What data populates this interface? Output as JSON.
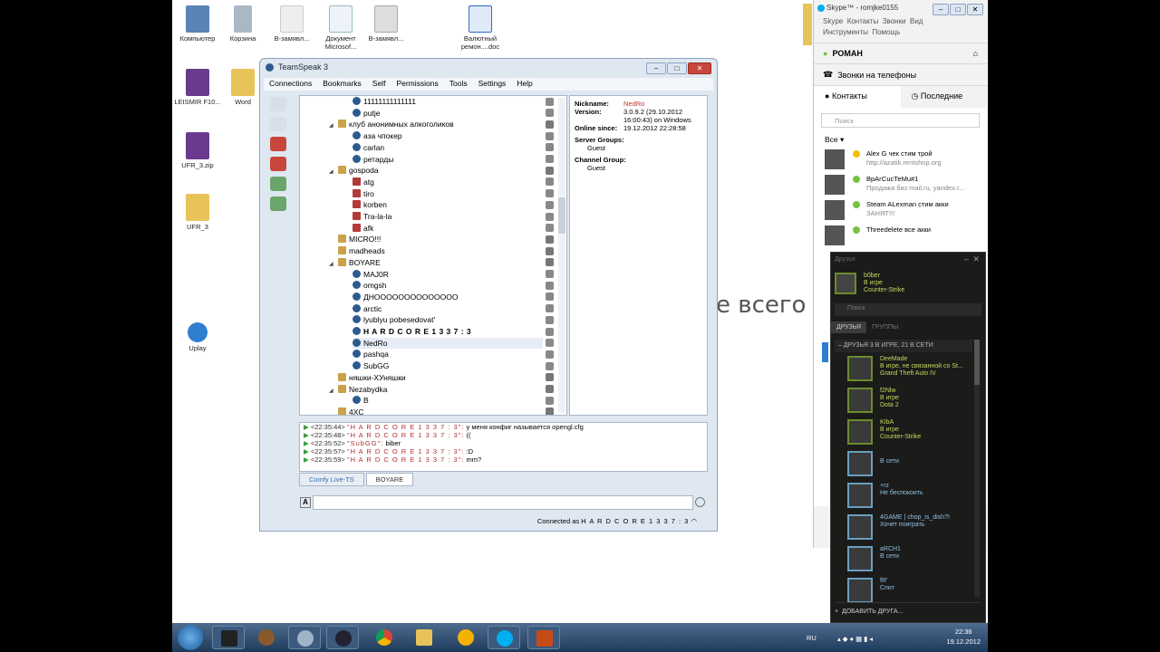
{
  "desktop": {
    "icons": [
      {
        "label": "Компьютер"
      },
      {
        "label": "Корзина"
      },
      {
        "label": "В-замявл..."
      },
      {
        "label": "Документ Microsof..."
      },
      {
        "label": "В-замявл..."
      },
      {
        "label": "Валютный ремон....doc"
      },
      {
        "label": "LEISMIR F10..."
      },
      {
        "label": "Word"
      },
      {
        "label": "UFR_3.zip"
      },
      {
        "label": "UFR_3"
      },
      {
        "label": "Uplay"
      }
    ],
    "background_text": "е всего"
  },
  "teamspeak": {
    "title": "TeamSpeak 3",
    "menu": [
      "Connections",
      "Bookmarks",
      "Self",
      "Permissions",
      "Tools",
      "Settings",
      "Help"
    ],
    "tree": [
      {
        "type": "client",
        "indent": 2,
        "label": "11111111111111"
      },
      {
        "type": "client",
        "indent": 2,
        "label": "putje"
      },
      {
        "type": "channel",
        "indent": 1,
        "label": "клуб анонимных алкоголиков",
        "expand": true
      },
      {
        "type": "client",
        "indent": 2,
        "label": "аза чпокер"
      },
      {
        "type": "client",
        "indent": 2,
        "label": "carlan"
      },
      {
        "type": "client",
        "indent": 2,
        "label": "ретарды"
      },
      {
        "type": "channel",
        "indent": 1,
        "label": "gospoda",
        "expand": true
      },
      {
        "type": "mute",
        "indent": 2,
        "label": "atg"
      },
      {
        "type": "mute",
        "indent": 2,
        "label": "tiro"
      },
      {
        "type": "mute",
        "indent": 2,
        "label": "korben"
      },
      {
        "type": "mute",
        "indent": 2,
        "label": "Tra-la-la"
      },
      {
        "type": "mute",
        "indent": 2,
        "label": "afk"
      },
      {
        "type": "channel",
        "indent": 1,
        "label": "MICRO!!!"
      },
      {
        "type": "channel",
        "indent": 1,
        "label": "madheads"
      },
      {
        "type": "channel",
        "indent": 1,
        "label": "BOYARE",
        "expand": true
      },
      {
        "type": "client",
        "indent": 2,
        "label": "MAJ0R"
      },
      {
        "type": "client",
        "indent": 2,
        "label": "omgsh"
      },
      {
        "type": "client",
        "indent": 2,
        "label": "ДНОOOOOOOOOOOOOO"
      },
      {
        "type": "client",
        "indent": 2,
        "label": "arctic"
      },
      {
        "type": "client",
        "indent": 2,
        "label": "lyublyu pobesedovat'"
      },
      {
        "type": "client",
        "indent": 2,
        "label": "H A R D C O R E  1 3 3 7 : 3",
        "bold": true
      },
      {
        "type": "client",
        "indent": 2,
        "label": "NedRo",
        "selected": true
      },
      {
        "type": "client",
        "indent": 2,
        "label": "pashqa"
      },
      {
        "type": "client",
        "indent": 2,
        "label": "SubGG"
      },
      {
        "type": "channel",
        "indent": 1,
        "label": "няшки-ХУняшки"
      },
      {
        "type": "channel",
        "indent": 1,
        "label": "Nezabydka",
        "expand": true
      },
      {
        "type": "client",
        "indent": 2,
        "label": "B"
      },
      {
        "type": "channel",
        "indent": 1,
        "label": "4XC"
      }
    ],
    "info": {
      "nickname_label": "Nickname:",
      "nickname": "NedRo",
      "version_label": "Version:",
      "version_l1": "3.0.9.2 (29.10.2012",
      "version_l2": "16:00:43) on Windows",
      "online_label": "Online since:",
      "online": "19.12.2012 22:28:58",
      "server_groups_label": "Server Groups:",
      "server_group": "Guest",
      "channel_group_label": "Channel Group:",
      "channel_group": "Guest"
    },
    "chat": [
      {
        "time": "<22:35:44>",
        "name": "\"H A R D C O R E  1 3 3 7 : 3\":",
        "msg": "у меня конфиг называется opengl.cfg"
      },
      {
        "time": "<22:35:48>",
        "name": "\"H A R D C O R E  1 3 3 7 : 3\":",
        "msg": "(("
      },
      {
        "time": "<22:35:52>",
        "name": "\"SubGG\":",
        "msg": "biber"
      },
      {
        "time": "<22:35:57>",
        "name": "\"H A R D C O R E  1 3 3 7 : 3\":",
        "msg": ":D"
      },
      {
        "time": "<22:35:59>",
        "name": "\"H A R D C O R E  1 3 3 7 : 3\":",
        "msg": "mm?"
      }
    ],
    "tabs": [
      "Comfy Live-TS",
      "BOYARE"
    ],
    "status_prefix": "Connected as",
    "status_name": "H A R D C O R E  1 3 3 7 : 3"
  },
  "skype": {
    "title": "Skype™ - romjke0155",
    "menu_row1": [
      "Skype",
      "Контакты",
      "Звонки",
      "Вид"
    ],
    "menu_row2": [
      "Инструменты",
      "Помощь"
    ],
    "user": "РОМАН",
    "phones": "Звонки на телефоны",
    "tab_contacts": "Контакты",
    "tab_recent": "Последние",
    "search_placeholder": "Поиск",
    "filter": "Все",
    "contacts": [
      {
        "name": "Alex G чек стим трой",
        "status": "http://azatik.rentshop.org",
        "dot": "y"
      },
      {
        "name": "ВрАгСuсТеМu#1",
        "status": "Продажа баз mail.ru, yandex.r...",
        "dot": "g"
      },
      {
        "name": "Steam ALexman стим акки",
        "status": "ЗАНЯТ!!!",
        "dot": "g"
      },
      {
        "name": "Threedelete все акки",
        "status": "",
        "dot": "g"
      }
    ]
  },
  "steam": {
    "header": "Друзья",
    "me_name": "b0ber",
    "me_status": "В игре",
    "me_game": "Counter-Strike",
    "search_placeholder": "Поиск",
    "tab_friends": "ДРУЗЬЯ",
    "tab_groups": "ГРУППЫ",
    "group_header": "– ДРУЗЬЯ   3 В ИГРЕ, 21 В СЕТИ",
    "friends": [
      {
        "name": "DeeMade",
        "s1": "В игре, не связанной со St...",
        "s2": "Grand Theft Auto IV",
        "ingame": true
      },
      {
        "name": "f2Nlw",
        "s1": "В игре",
        "s2": "Dota 2",
        "ingame": true
      },
      {
        "name": "KIbA",
        "s1": "В игре",
        "s2": "Counter-Strike",
        "ingame": true
      },
      {
        "name": "",
        "s1": "В сети",
        "s2": "",
        "ingame": false
      },
      {
        "name": "+rz",
        "s1": "Не беспокоить",
        "s2": "",
        "ingame": false
      },
      {
        "name": "4GAME | chop_is_dish?!",
        "s1": "Хочет поиграть",
        "s2": "",
        "ingame": false
      },
      {
        "name": "aRCH1",
        "s1": "В сети",
        "s2": "",
        "ingame": false
      },
      {
        "name": "fR'",
        "s1": "Спит",
        "s2": "",
        "ingame": false
      }
    ],
    "add_friend": "ДОБАВИТЬ ДРУГА..."
  },
  "taskbar": {
    "lang": "RU",
    "time": "22:36",
    "date": "19.12.2012"
  }
}
